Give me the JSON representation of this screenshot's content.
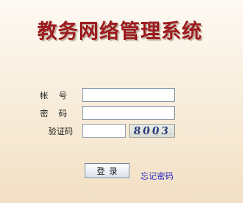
{
  "title": "教务网络管理系统",
  "form": {
    "account_label": "帐    号",
    "account_value": "",
    "password_label": "密    码",
    "password_value": "",
    "captcha_label": "验证码",
    "captcha_value": "",
    "captcha_image_text": "8003"
  },
  "actions": {
    "login_label": "登录",
    "forgot_label": "忘记密码"
  },
  "colors": {
    "title": "#9d1a1e",
    "link": "#1a1acc"
  }
}
